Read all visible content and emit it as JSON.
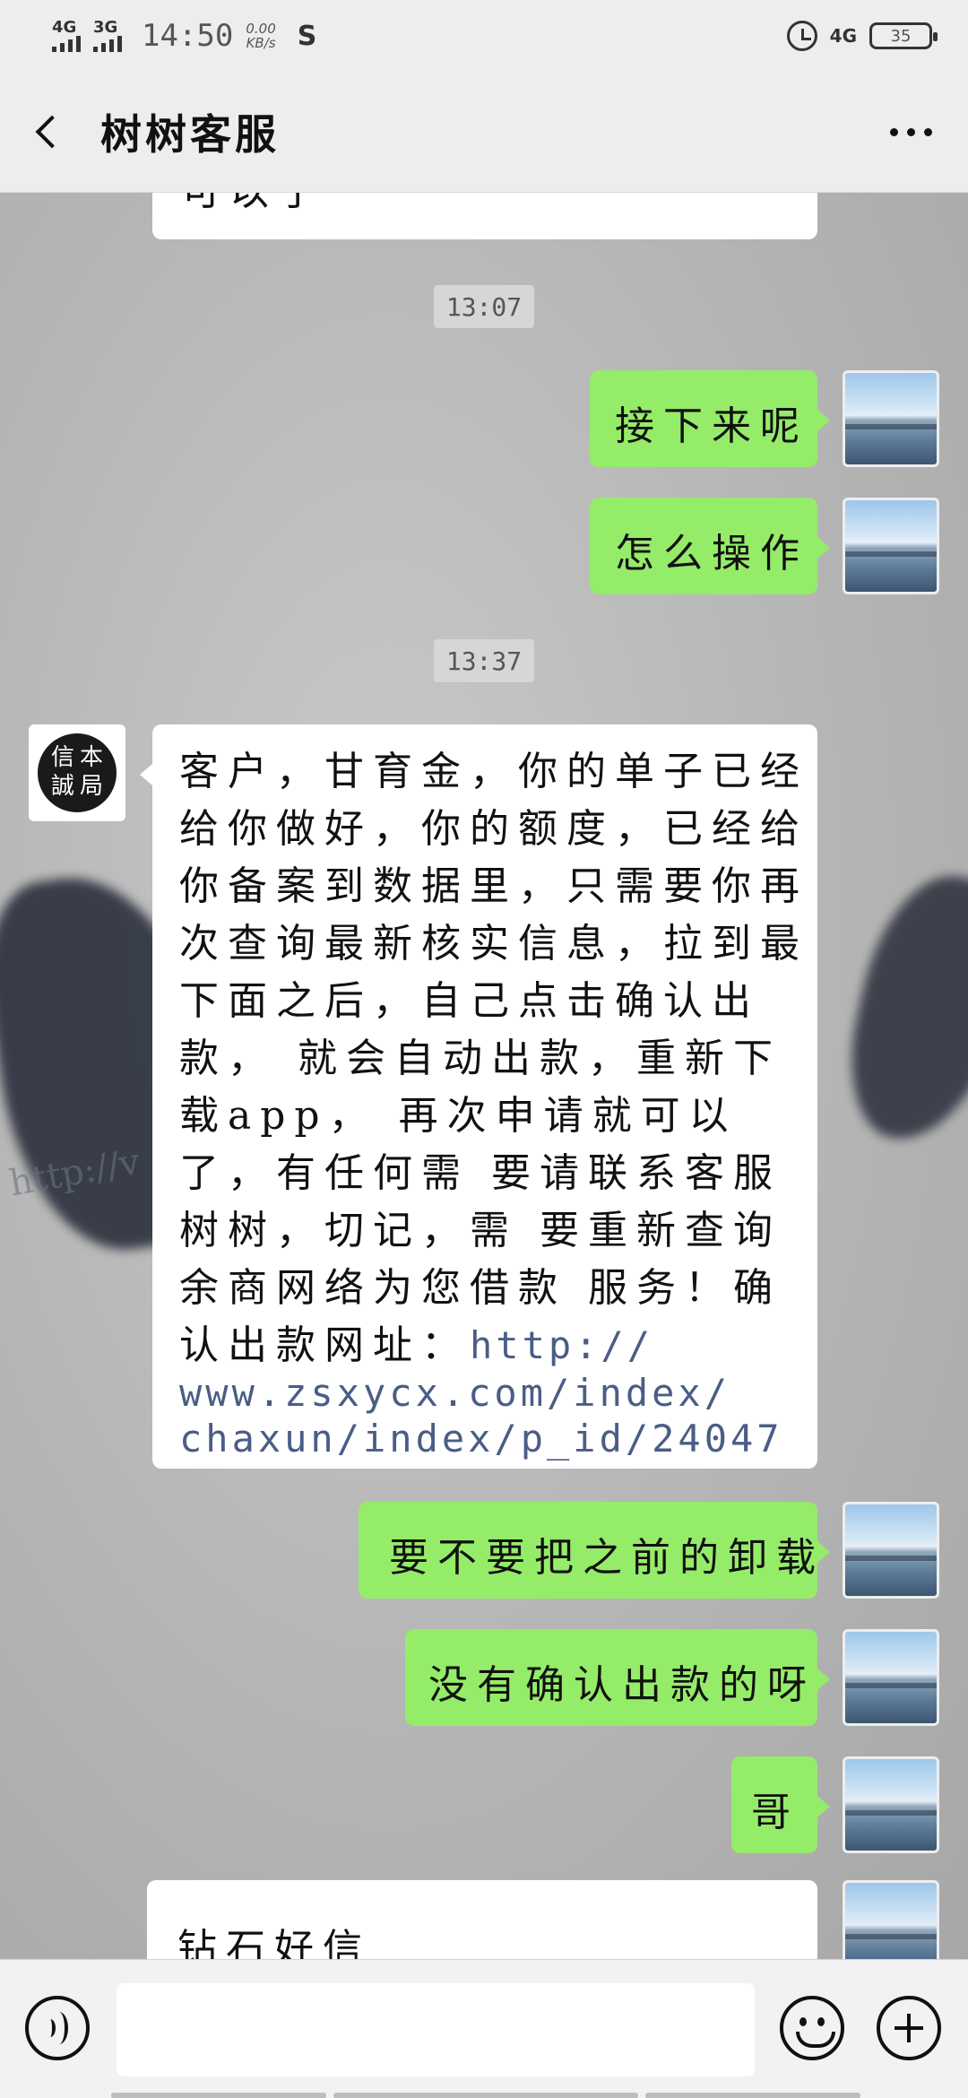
{
  "status_bar": {
    "net1": "4G",
    "net2": "3G",
    "time": "14:50",
    "speed_value": "0.00",
    "speed_unit": "KB/s",
    "app_indicator": "S",
    "net_right": "4G",
    "battery": "35"
  },
  "header": {
    "title": "树树客服",
    "back_icon": "chevron-left-icon",
    "more_icon": "more-icon"
  },
  "chat": {
    "prev_fragment": "可以了",
    "timestamps": [
      "13:07",
      "13:37"
    ],
    "messages_sent_1": [
      "接下来呢",
      "怎么操作"
    ],
    "avatar_other_text": [
      "信",
      "本",
      "誠",
      "局"
    ],
    "long_message": {
      "lines": [
        "客户，甘育金，你的单子已经",
        "给你做好，你的额度，已经给",
        "你备案到数据里，只需要你再",
        "次查询最新核实信息，拉到最",
        "下面之后，自己点击确认出款，",
        "就会自动出款，重新下载app，",
        "再次申请就可以了，有任何需",
        "要请联系客服树树，切记，需",
        "要重新查询余商网络为您借款",
        "服务！确认出款网址："
      ],
      "link_part1": "http://",
      "link_part2": "www.zsxycx.com/index/",
      "link_part3": "chaxun/index/p_id/24047"
    },
    "messages_sent_2": [
      "要不要把之前的卸载",
      "没有确认出款的呀",
      "哥"
    ],
    "partial_message": "钻石好信"
  },
  "input_bar": {
    "voice_icon": "voice-icon",
    "emoji_icon": "emoji-icon",
    "plus_icon": "plus-icon"
  },
  "colors": {
    "sent_bubble": "#95ec69",
    "received_bubble": "#ffffff",
    "bar_bg": "#ededed",
    "link": "#4a5d86"
  }
}
